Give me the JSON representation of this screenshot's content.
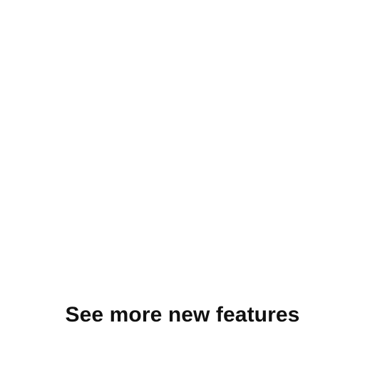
{
  "caption": {
    "text": "See more new features"
  },
  "colors": {
    "background": "#ffffff",
    "text": "#111111"
  }
}
